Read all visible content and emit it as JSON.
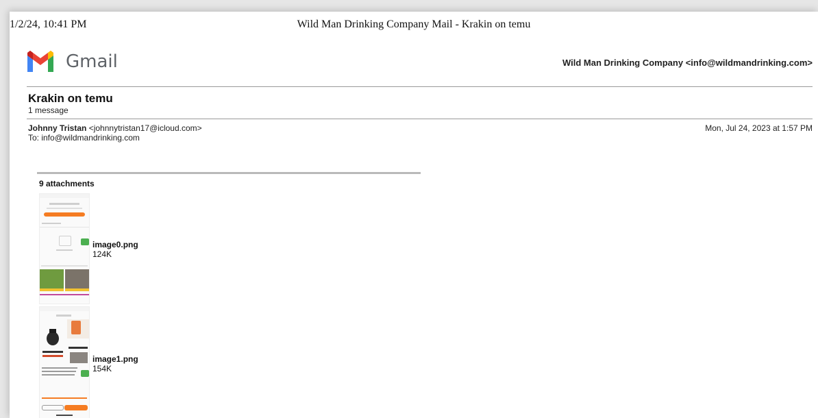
{
  "print_header": {
    "datetime": "1/2/24, 10:41 PM",
    "title": "Wild Man Drinking Company Mail - Krakin on temu"
  },
  "brand": {
    "logo_text": "Gmail"
  },
  "account": {
    "label": "Wild Man Drinking Company <info@wildmandrinking.com>"
  },
  "thread": {
    "subject": "Krakin on temu",
    "message_count": "1 message"
  },
  "message": {
    "sender_name": "Johnny Tristan",
    "sender_email": "<johnnytristan17@icloud.com>",
    "to": "To: info@wildmandrinking.com",
    "date": "Mon, Jul 24, 2023 at 1:57 PM"
  },
  "attachments": {
    "title": "9 attachments",
    "items": [
      {
        "name": "image0.png",
        "size": "124K"
      },
      {
        "name": "image1.png",
        "size": "154K"
      }
    ]
  },
  "colors": {
    "gmail_red": "#ea4335",
    "gmail_blue": "#4285f4",
    "gmail_green": "#34a853",
    "gmail_yellow": "#fbbc04",
    "temu_orange": "#f57c22"
  }
}
